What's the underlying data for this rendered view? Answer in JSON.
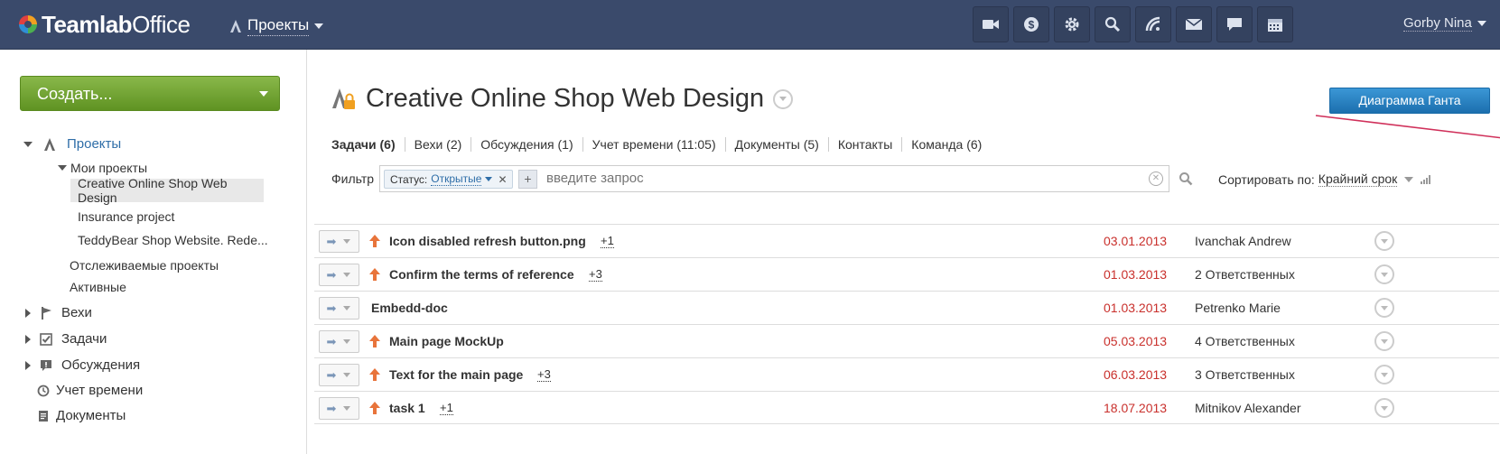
{
  "topbar": {
    "logo_bold": "Teamlab",
    "logo_light": "Office",
    "module_label": "Проекты",
    "user_name": "Gorby Nina",
    "icons": [
      "video-icon",
      "money-icon",
      "gear-icon",
      "search-icon",
      "feed-icon",
      "mail-icon",
      "chat-icon",
      "calendar-icon"
    ]
  },
  "sidebar": {
    "create_label": "Создать...",
    "projects_label": "Проекты",
    "my_projects_label": "Мои проекты",
    "my_projects": [
      "Creative Online Shop Web Design",
      "Insurance project",
      "TeddyBear Shop Website. Rede..."
    ],
    "followed_label": "Отслеживаемые проекты",
    "active_label": "Активные",
    "milestones_label": "Вехи",
    "tasks_label": "Задачи",
    "discussions_label": "Обсуждения",
    "timetracking_label": "Учет времени",
    "documents_label": "Документы"
  },
  "main": {
    "project_title": "Creative Online Shop Web Design",
    "gantt_label": "Диаграмма Ганта",
    "tabs": [
      "Задачи (6)",
      "Вехи (2)",
      "Обсуждения (1)",
      "Учет времени (11:05)",
      "Документы (5)",
      "Контакты",
      "Команда (6)"
    ],
    "filter_label": "Фильтр",
    "chip_key": "Статус:",
    "chip_value": "Открытые",
    "query_placeholder": "введите запрос",
    "sort_label": "Сортировать по:",
    "sort_value": "Крайний срок",
    "colors": {
      "accent": "#2f6ea8",
      "date": "#c9302c",
      "priority": "#e8743b"
    },
    "tasks": [
      {
        "name": "Icon disabled refresh button.png",
        "extra": "+1",
        "date": "03.01.2013",
        "resp": "Ivanchak Andrew",
        "priority": true
      },
      {
        "name": "Confirm the terms of reference",
        "extra": "+3",
        "date": "01.03.2013",
        "resp": "2 Ответственных",
        "priority": true
      },
      {
        "name": "Embedd-doc",
        "extra": "",
        "date": "01.03.2013",
        "resp": "Petrenko Marie",
        "priority": false
      },
      {
        "name": "Main page MockUp",
        "extra": "",
        "date": "05.03.2013",
        "resp": "4 Ответственных",
        "priority": true
      },
      {
        "name": "Text for the main page",
        "extra": "+3",
        "date": "06.03.2013",
        "resp": "3 Ответственных",
        "priority": true
      },
      {
        "name": "task 1",
        "extra": "+1",
        "date": "18.07.2013",
        "resp": "Mitnikov Alexander",
        "priority": true
      }
    ]
  }
}
